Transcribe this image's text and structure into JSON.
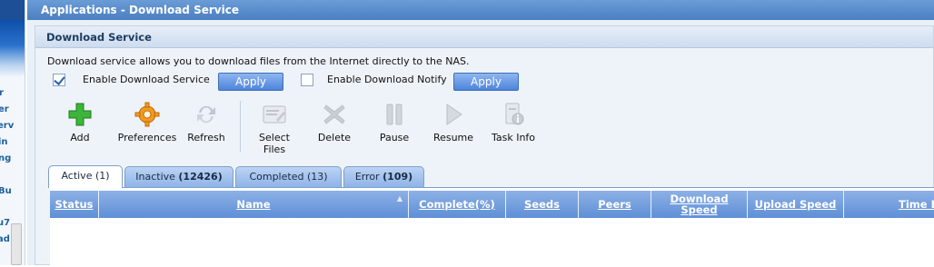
{
  "sidebar_fragment": {
    "items": [
      "r",
      "er",
      "erv",
      "in",
      "ng",
      "Bu",
      "u7",
      "ad"
    ]
  },
  "window": {
    "title": "Applications - Download Service"
  },
  "panel": {
    "title": "Download Service",
    "description": "Download service allows you to download files from the Internet directly to the NAS.",
    "enable_download_service": {
      "label": "Enable Download Service",
      "checked": true,
      "apply_label": "Apply"
    },
    "enable_download_notify": {
      "label": "Enable Download Notify",
      "checked": false,
      "apply_label": "Apply"
    }
  },
  "toolbar": {
    "add": "Add",
    "preferences": "Preferences",
    "refresh": "Refresh",
    "select_files_line1": "Select",
    "select_files_line2": "Files",
    "delete": "Delete",
    "pause": "Pause",
    "resume": "Resume",
    "task_info": "Task Info"
  },
  "tabs": [
    {
      "name": "Active",
      "count": "(1)",
      "count_bold": false
    },
    {
      "name": "Inactive",
      "count": "(12426)",
      "count_bold": true
    },
    {
      "name": "Completed",
      "count": "(13)",
      "count_bold": false
    },
    {
      "name": "Error",
      "count": "(109)",
      "count_bold": true
    }
  ],
  "grid": {
    "columns": {
      "status": "Status",
      "name": "Name",
      "complete": "Complete(%)",
      "seeds": "Seeds",
      "peers": "Peers",
      "download_speed_line1": "Download",
      "download_speed_line2": "Speed",
      "upload_speed": "Upload Speed",
      "time": "Time L"
    },
    "sort_indicator": "▲"
  },
  "colors": {
    "titlebar": "#5a8ccc",
    "tab_active": "#ffffff",
    "tab_inactive": "#9dbdeb",
    "grid_header": "#6f9bdc",
    "apply_button": "#5a8fe0"
  }
}
